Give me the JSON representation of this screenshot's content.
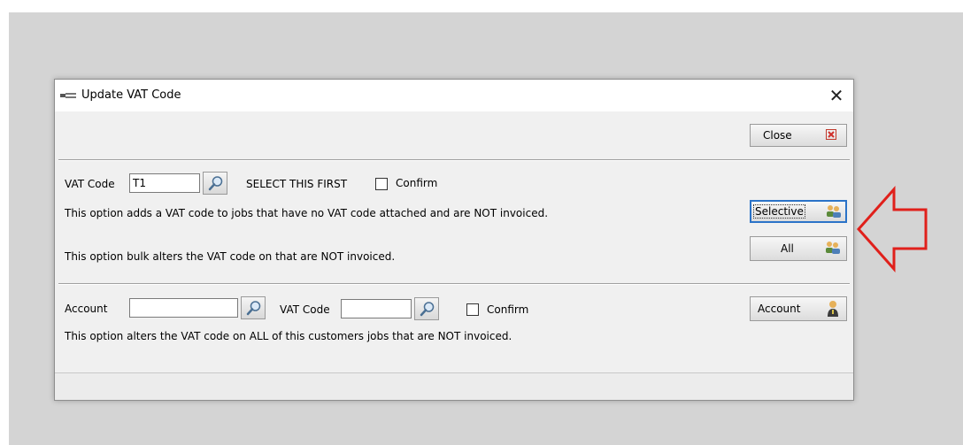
{
  "window": {
    "title": "Update VAT Code",
    "icon": "tool-icon",
    "close_glyph": "✕"
  },
  "toolbar": {
    "close_label": "Close",
    "close_icon": "close-red-icon"
  },
  "section1": {
    "vat_code_label": "VAT Code",
    "vat_code_value": "T1",
    "select_first_text": "SELECT THIS FIRST",
    "confirm_label": "Confirm",
    "selective_desc": "This option adds a VAT code to jobs that have no VAT code attached and are NOT invoiced.",
    "selective_label": "Selective",
    "bulk_desc": "This option bulk alters the VAT code on that are NOT invoiced.",
    "all_label": "All"
  },
  "section2": {
    "account_label": "Account",
    "account_value": "",
    "vat_code_label": "VAT Code",
    "vat_code_value": "",
    "confirm_label": "Confirm",
    "account_button_label": "Account",
    "desc": "This option alters the VAT code on ALL of this customers jobs that are NOT invoiced."
  },
  "annotation": {
    "arrow_color": "#e0201b",
    "arrow_icon": "left-arrow-annotation"
  }
}
